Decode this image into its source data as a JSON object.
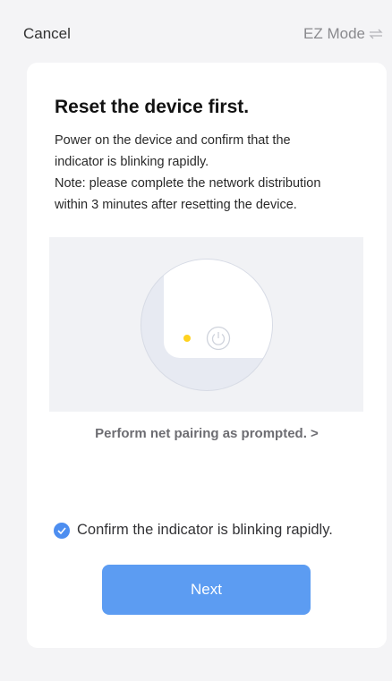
{
  "header": {
    "cancel_label": "Cancel",
    "mode_label": "EZ Mode",
    "mode_icon": "swap-arrows-icon"
  },
  "card": {
    "title": "Reset the device first.",
    "description": [
      "Power on the device and confirm that the",
      "indicator is blinking rapidly.",
      "Note: please complete the network distribution",
      "within 3 minutes after resetting the device."
    ],
    "illustration": {
      "indicator_color": "#ffd21f",
      "icon": "power-icon"
    },
    "pairing_link": "Perform net pairing as prompted. >",
    "confirm": {
      "checked": true,
      "label": "Confirm the indicator is blinking rapidly."
    },
    "next_label": "Next"
  },
  "colors": {
    "accent": "#5c9cf2",
    "check": "#4d8ef0",
    "background": "#f4f4f6",
    "card": "#ffffff"
  }
}
